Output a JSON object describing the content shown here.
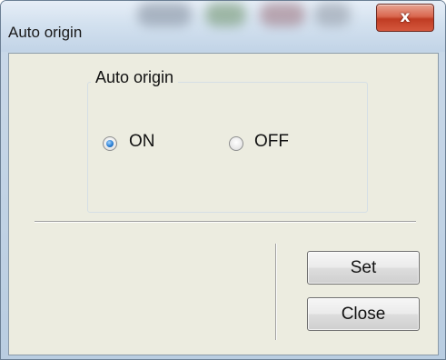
{
  "window": {
    "title": "Auto origin",
    "close_glyph": "x"
  },
  "group": {
    "label": "Auto origin",
    "options": [
      {
        "label": "ON",
        "selected": true
      },
      {
        "label": "OFF",
        "selected": false
      }
    ]
  },
  "buttons": {
    "set_label": "Set",
    "close_label": "Close"
  },
  "icons": {
    "close": "close-icon",
    "radio_on": "radio-checked",
    "radio_off": "radio-unchecked"
  },
  "colors": {
    "dialog_background": "#ecece0",
    "close_button": "#c03c23",
    "radio_selected": "#2a7fd4"
  }
}
